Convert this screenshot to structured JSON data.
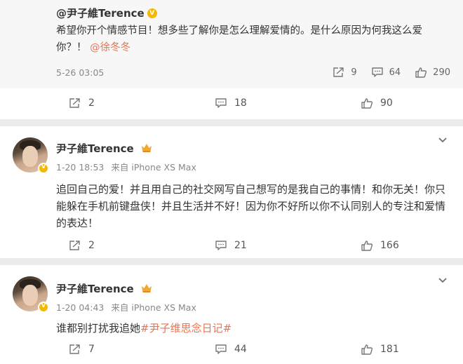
{
  "repost": {
    "author": "@尹子維Terence",
    "text_main": "希望你开个情感节目！想多些了解你是怎么理解爱情的。是什么原因为何我这么爱你？！",
    "mention": "@徐冬冬",
    "time": "5-26 03:05",
    "actions": {
      "repost_count": "9",
      "comment_count": "64",
      "like_count": "290"
    }
  },
  "post1_actions": {
    "repost_count": "2",
    "comment_count": "18",
    "like_count": "90"
  },
  "comments": [
    {
      "author": "尹子維Terence",
      "time": "1-20 18:53",
      "source_prefix": "来自",
      "source": "iPhone XS Max",
      "text": "追回自己的爱！并且用自己的社交网写自己想写的是我自己的事情！和你无关！你只能躲在手机前键盘侠！并且生活并不好！因为你不好所以你不认同别人的专注和爱情的表达！",
      "repost_count": "2",
      "comment_count": "21",
      "like_count": "166"
    },
    {
      "author": "尹子維Terence",
      "time": "1-20 04:43",
      "source_prefix": "来自",
      "source": "iPhone XS Max",
      "text_main": "谁都别打扰我追她",
      "hashtag": "#尹子维思念日记#",
      "repost_count": "7",
      "comment_count": "44",
      "like_count": "181"
    }
  ],
  "colors": {
    "link": "#eb7350",
    "badge": "#f5b800",
    "muted": "#888888"
  }
}
